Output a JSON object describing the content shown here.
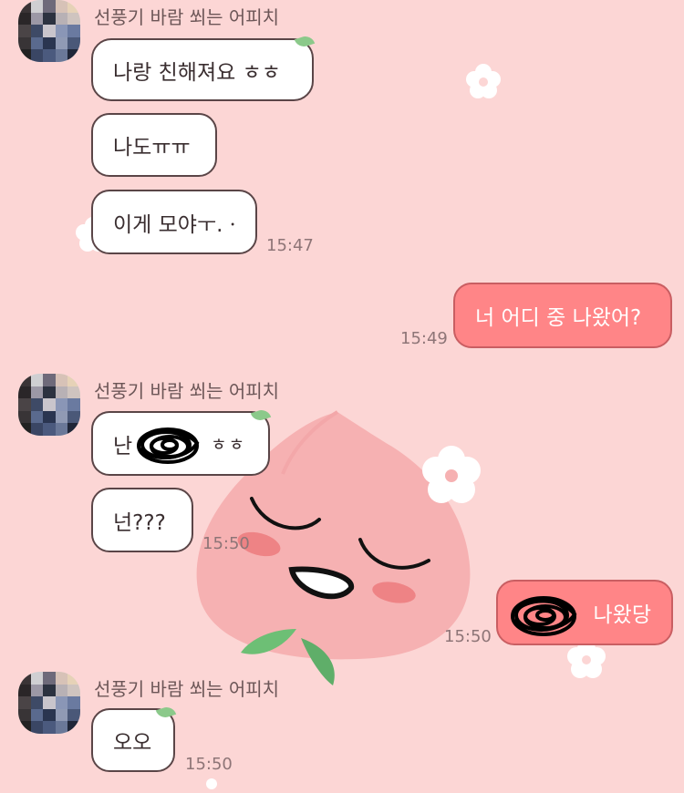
{
  "chat": {
    "sender_name": "선풍기 바람 쐬는 어피치",
    "messages": [
      {
        "text": "나랑 친해져요 ㅎㅎ"
      },
      {
        "text": "나도ㅠㅠ"
      },
      {
        "text": "이게 모야ㅜ.ㆍ",
        "time": "15:47"
      },
      {
        "text": "너 어디 중 나왔어?",
        "time": "15:49"
      },
      {
        "text": "난",
        "suffix": "ㅎㅎ"
      },
      {
        "text": "넌???",
        "time": "15:50"
      },
      {
        "text": "나왔당",
        "time": "15:50"
      },
      {
        "text": "오오",
        "time": "15:50"
      }
    ]
  },
  "icons": {
    "avatar": "avatar-icon",
    "leaf": "leaf-icon",
    "redaction": "scribble-redaction"
  },
  "colors": {
    "background": "#FCD6D5",
    "incoming_bubble": "#FFFFFF",
    "outgoing_bubble": "#FF8587",
    "peach": "#F6B1B2"
  }
}
